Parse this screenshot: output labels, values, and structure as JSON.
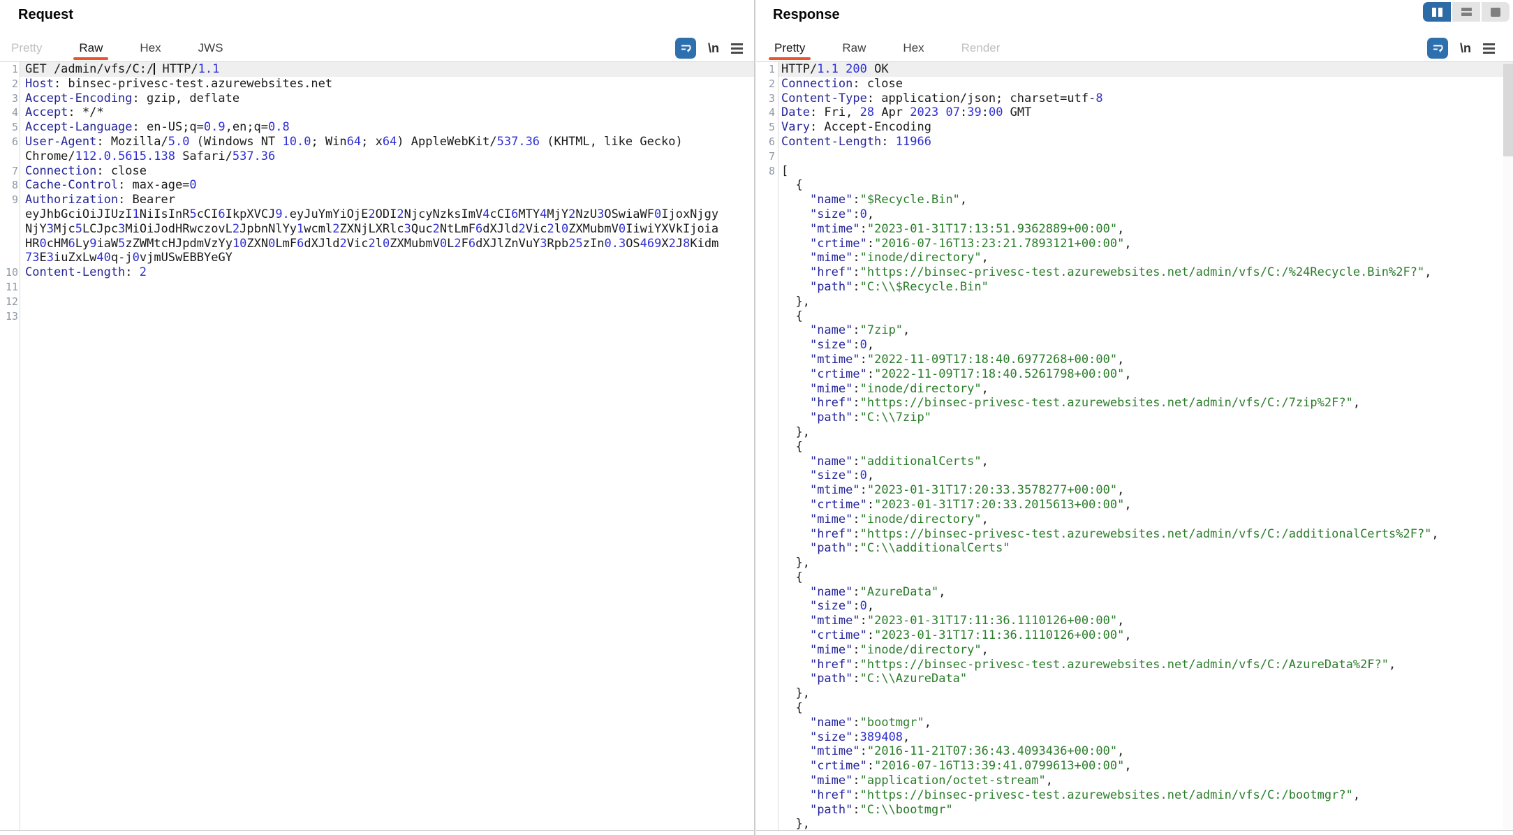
{
  "colors": {
    "accent_orange": "#e9552d",
    "selected_blue": "#2c6ba6",
    "key_navy": "#26269b",
    "string_green": "#2b7d2b",
    "number_blue": "#2f2fd3",
    "line_number_gray": "#8d99a6",
    "row_highlight": "#efefef"
  },
  "layout_toggle": {
    "buttons": [
      {
        "name": "split-columns",
        "icon": "two-columns-icon",
        "selected": true
      },
      {
        "name": "split-rows",
        "icon": "two-rows-icon",
        "selected": false
      },
      {
        "name": "single-panel",
        "icon": "square-icon",
        "selected": false
      }
    ]
  },
  "request": {
    "title": "Request",
    "tabs": [
      {
        "label": "Pretty",
        "state": "muted"
      },
      {
        "label": "Raw",
        "state": "active"
      },
      {
        "label": "Hex",
        "state": "normal"
      },
      {
        "label": "JWS",
        "state": "normal"
      }
    ],
    "toolbar": {
      "wrap_icon": "word-wrap-icon",
      "newline_label": "\\n",
      "menu_icon": "menu-icon"
    },
    "rows": [
      {
        "n": "1",
        "type": "start",
        "text": "GET /admin/vfs/C:/ HTTP/1.1",
        "hl": true,
        "caret": 18
      },
      {
        "n": "2",
        "type": "header",
        "text": "Host: binsec-privesc-test.azurewebsites.net"
      },
      {
        "n": "3",
        "type": "header",
        "text": "Accept-Encoding: gzip, deflate"
      },
      {
        "n": "4",
        "type": "header",
        "text": "Accept: */*"
      },
      {
        "n": "5",
        "type": "header",
        "text": "Accept-Language: en-US;q=0.9,en;q=0.8"
      },
      {
        "n": "6",
        "type": "header",
        "text": "User-Agent: Mozilla/5.0 (Windows NT 10.0; Win64; x64) AppleWebKit/537.36 (KHTML, like Gecko)"
      },
      {
        "n": "",
        "type": "plain",
        "text": "Chrome/112.0.5615.138 Safari/537.36"
      },
      {
        "n": "7",
        "type": "header",
        "text": "Connection: close"
      },
      {
        "n": "8",
        "type": "header",
        "text": "Cache-Control: max-age=0"
      },
      {
        "n": "9",
        "type": "header",
        "text": "Authorization: Bearer"
      },
      {
        "n": "",
        "type": "plain",
        "text": "eyJhbGciOiJIUzI1NiIsInR5cCI6IkpXVCJ9.eyJuYmYiOjE2ODI2NjcyNzksImV4cCI6MTY4MjY2NzU3OSwiaWF0IjoxNjgy"
      },
      {
        "n": "",
        "type": "plain",
        "text": "NjY3Mjc5LCJpc3MiOiJodHRwczovL2JpbnNlYy1wcml2ZXNjLXRlc3Quc2NtLmF6dXJld2Vic2l0ZXMubmV0IiwiYXVkIjoia"
      },
      {
        "n": "",
        "type": "plain",
        "text": "HR0cHM6Ly9iaW5zZWMtcHJpdmVzYy10ZXN0LmF6dXJld2Vic2l0ZXMubmV0L2F6dXJlZnVuY3Rpb25zIn0.3OS469X2J8Kidm"
      },
      {
        "n": "",
        "type": "plain",
        "text": "73E3iuZxLw40q-j0vjmUSwEBBYeGY"
      },
      {
        "n": "10",
        "type": "header",
        "text": "Content-Length: 2"
      },
      {
        "n": "11",
        "type": "plain",
        "text": ""
      },
      {
        "n": "12",
        "type": "plain",
        "text": ""
      },
      {
        "n": "13",
        "type": "plain",
        "text": ""
      }
    ]
  },
  "response": {
    "title": "Response",
    "tabs": [
      {
        "label": "Pretty",
        "state": "active"
      },
      {
        "label": "Raw",
        "state": "normal"
      },
      {
        "label": "Hex",
        "state": "normal"
      },
      {
        "label": "Render",
        "state": "muted"
      }
    ],
    "toolbar": {
      "wrap_icon": "word-wrap-icon",
      "newline_label": "\\n",
      "menu_icon": "menu-icon"
    },
    "header_rows": [
      {
        "n": "1",
        "type": "start",
        "text": "HTTP/1.1 200 OK",
        "hl": true
      },
      {
        "n": "2",
        "type": "header",
        "text": "Connection: close"
      },
      {
        "n": "3",
        "type": "header",
        "text": "Content-Type: application/json; charset=utf-8"
      },
      {
        "n": "4",
        "type": "header",
        "text": "Date: Fri, 28 Apr 2023 07:39:00 GMT"
      },
      {
        "n": "5",
        "type": "header",
        "text": "Vary: Accept-Encoding"
      },
      {
        "n": "6",
        "type": "header",
        "text": "Content-Length: 11966"
      },
      {
        "n": "7",
        "type": "plain",
        "text": ""
      },
      {
        "n": "8",
        "type": "plain",
        "text": "["
      }
    ],
    "body_entries": [
      {
        "name": "$Recycle.Bin",
        "size": 0,
        "mtime": "2023-01-31T17:13:51.9362889+00:00",
        "crtime": "2016-07-16T13:23:21.7893121+00:00",
        "mime": "inode/directory",
        "href": "https://binsec-privesc-test.azurewebsites.net/admin/vfs/C:/%24Recycle.Bin%2F?",
        "path": "C:\\\\$Recycle.Bin"
      },
      {
        "name": "7zip",
        "size": 0,
        "mtime": "2022-11-09T17:18:40.6977268+00:00",
        "crtime": "2022-11-09T17:18:40.5261798+00:00",
        "mime": "inode/directory",
        "href": "https://binsec-privesc-test.azurewebsites.net/admin/vfs/C:/7zip%2F?",
        "path": "C:\\\\7zip"
      },
      {
        "name": "additionalCerts",
        "size": 0,
        "mtime": "2023-01-31T17:20:33.3578277+00:00",
        "crtime": "2023-01-31T17:20:33.2015613+00:00",
        "mime": "inode/directory",
        "href": "https://binsec-privesc-test.azurewebsites.net/admin/vfs/C:/additionalCerts%2F?",
        "path": "C:\\\\additionalCerts"
      },
      {
        "name": "AzureData",
        "size": 0,
        "mtime": "2023-01-31T17:11:36.1110126+00:00",
        "crtime": "2023-01-31T17:11:36.1110126+00:00",
        "mime": "inode/directory",
        "href": "https://binsec-privesc-test.azurewebsites.net/admin/vfs/C:/AzureData%2F?",
        "path": "C:\\\\AzureData"
      },
      {
        "name": "bootmgr",
        "size": 389408,
        "mtime": "2016-11-21T07:36:43.4093436+00:00",
        "crtime": "2016-07-16T13:39:41.0799613+00:00",
        "mime": "application/octet-stream",
        "href": "https://binsec-privesc-test.azurewebsites.net/admin/vfs/C:/bootmgr?",
        "path": "C:\\\\bootmgr"
      }
    ]
  }
}
